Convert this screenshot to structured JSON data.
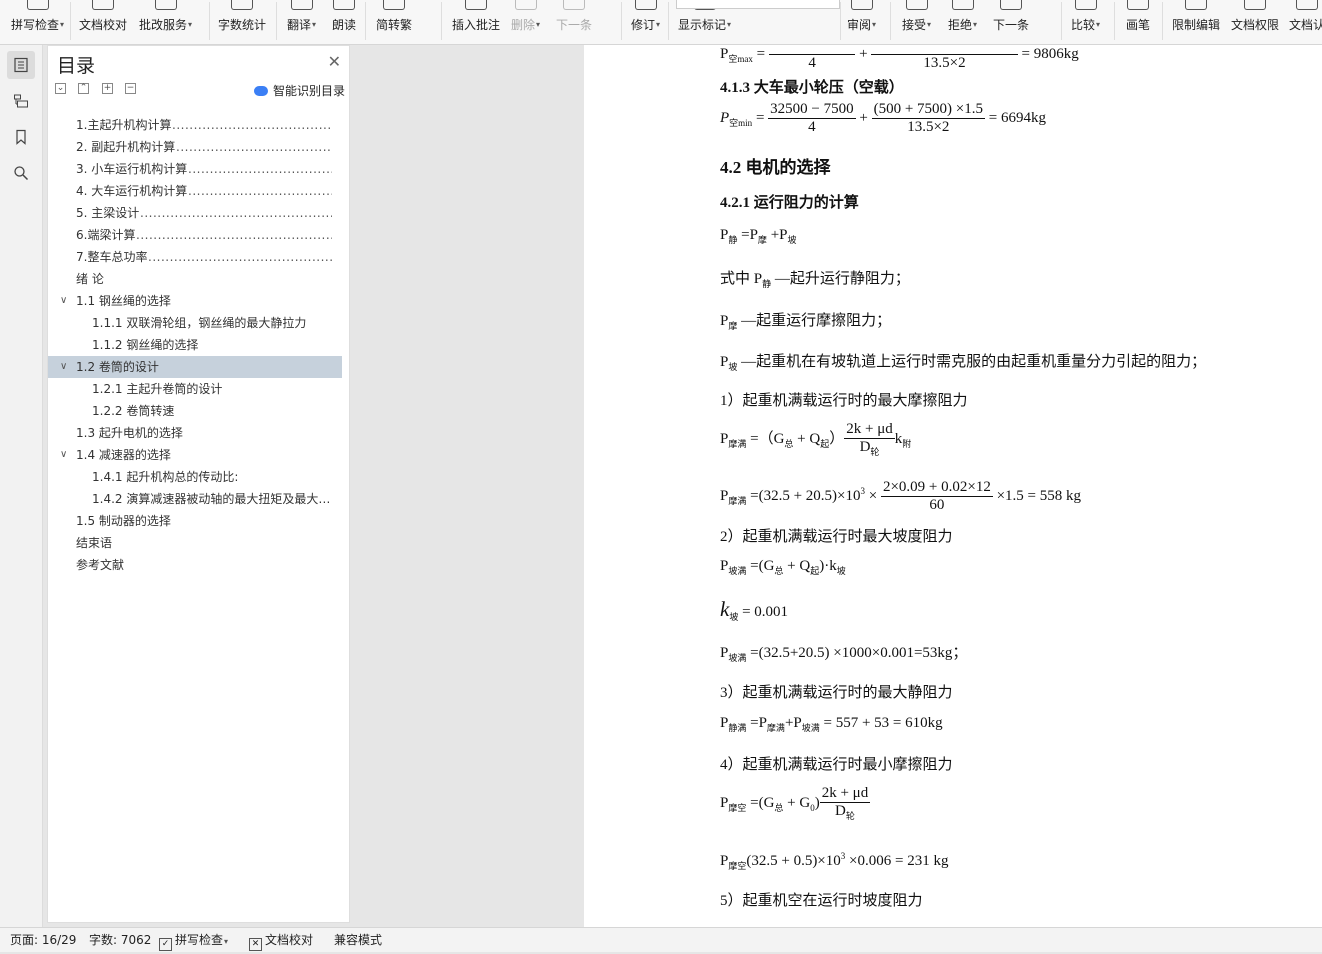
{
  "ribbon": {
    "buttons": [
      {
        "label": "拼写检查",
        "caret": true
      },
      {
        "label": "文档校对",
        "caret": false
      },
      {
        "label": "批改服务",
        "caret": true
      },
      {
        "label": "字数统计",
        "caret": false
      },
      {
        "label": "翻译",
        "caret": true
      },
      {
        "label": "朗读",
        "caret": false
      },
      {
        "label": "简转繁",
        "caret": false
      },
      {
        "label": "插入批注",
        "caret": false
      },
      {
        "label": "删除",
        "caret": true
      },
      {
        "label": "下一条",
        "caret": false
      },
      {
        "label": "修订",
        "caret": true
      },
      {
        "label": "显示标记",
        "caret": true
      },
      {
        "label": "审阅",
        "caret": true
      },
      {
        "label": "接受",
        "caret": true
      },
      {
        "label": "拒绝",
        "caret": true
      },
      {
        "label": "下一条",
        "caret": false
      },
      {
        "label": "比较",
        "caret": true
      },
      {
        "label": "画笔",
        "caret": false
      },
      {
        "label": "限制编辑",
        "caret": false
      },
      {
        "label": "文档权限",
        "caret": false
      },
      {
        "label": "文档认",
        "caret": false
      }
    ]
  },
  "toc": {
    "title": "目录",
    "smart_label": "智能识别目录",
    "items": [
      {
        "text": "1.主起升机构计算",
        "level": 1,
        "dots": true
      },
      {
        "text": "2.  副起升机构计算",
        "level": 1,
        "dots": true
      },
      {
        "text": "3.  小车运行机构计算",
        "level": 1,
        "dots": true
      },
      {
        "text": "4.  大车运行机构计算",
        "level": 1,
        "dots": true
      },
      {
        "text": "5.  主梁设计",
        "level": 1,
        "dots": true
      },
      {
        "text": "6.端梁计算",
        "level": 1,
        "dots": true
      },
      {
        "text": "7.整车总功率",
        "level": 1,
        "dots": true
      },
      {
        "text": "绪  论",
        "level": 1,
        "dots": false
      },
      {
        "text": "1.1 钢丝绳的选择",
        "level": 1,
        "expand": true,
        "dots": false
      },
      {
        "text": "1.1.1 双联滑轮组，钢丝绳的最大静拉力",
        "level": 2,
        "dots": false
      },
      {
        "text": "1.1.2 钢丝绳的选择",
        "level": 2,
        "dots": false
      },
      {
        "text": "1.2 卷筒的设计",
        "level": 1,
        "expand": true,
        "selected": true,
        "dots": false
      },
      {
        "text": "1.2.1 主起升卷筒的设计",
        "level": 2,
        "dots": false
      },
      {
        "text": "1.2.2 卷筒转速",
        "level": 2,
        "dots": false
      },
      {
        "text": "1.3 起升电机的选择",
        "level": 1,
        "dots": false
      },
      {
        "text": "1.4 减速器的选择",
        "level": 1,
        "expand": true,
        "dots": false
      },
      {
        "text": "1.4.1 起升机构总的传动比:",
        "level": 2,
        "dots": false
      },
      {
        "text": "1.4.2 演算减速器被动轴的最大扭矩及最大…",
        "level": 2,
        "dots": false
      },
      {
        "text": "1.5 制动器的选择",
        "level": 1,
        "dots": false
      },
      {
        "text": "结束语",
        "level": 1,
        "dots": false
      },
      {
        "text": "参考文献",
        "level": 1,
        "dots": false
      }
    ]
  },
  "document": {
    "eq_top_tail": "= 9806kg",
    "eq_top_den1": "4",
    "eq_top_den2": "13.5×2",
    "h_413": "4.1.3 大车最小轮压（空载）",
    "eq_pmin_num1": "32500 − 7500",
    "eq_pmin_den1": "4",
    "eq_pmin_num2": "(500 + 7500) ×1.5",
    "eq_pmin_den2": "13.5×2",
    "eq_pmin_tail": "= 6694kg",
    "h_42": "4.2 电机的选择",
    "h_421": "4.2.1 运行阻力的计算",
    "para_where": "—起升运行静阻力；",
    "para_where_prefix": "式中",
    "para_friction": "—起重运行摩擦阻力；",
    "para_slope": "—起重机在有坡轨道上运行时需克服的由起重机重量分力引起的阻力；",
    "item1": "1）起重机满载运行时的最大摩擦阻力",
    "eq_fric_frac_num": "2k + μd",
    "eq_fric_val_num": "2×0.09 + 0.02×12",
    "eq_fric_val_den": "60",
    "eq_fric_val_head": "=(32.5 + 20.5)×10",
    "eq_fric_val_tail": "×1.5 = 558 kg",
    "item2": "2）起重机满载运行时最大坡度阻力",
    "k_slope_val": "= 0.001",
    "eq_slope_val": "=(32.5+20.5) ×1000×0.001=53kg；",
    "item3": "3）起重机满载运行时的最大静阻力",
    "eq_static_tail": "= 557 + 53 = 610kg",
    "item4": "4）起重机满载运行时最小摩擦阻力",
    "eq_min_val_head": "(32.5 + 0.5)×10",
    "eq_min_val_tail": "×0.006 = 231 kg",
    "item5": "5）起重机空在运行时坡度阻力"
  },
  "status": {
    "page": "页面: 16/29",
    "words": "字数: 7062",
    "spell": "拼写检查",
    "proof": "文档校对",
    "compat": "兼容模式"
  }
}
